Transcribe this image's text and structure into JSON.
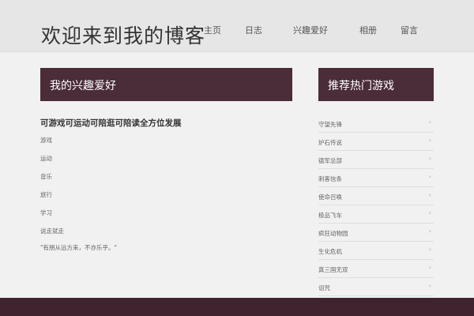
{
  "header": {
    "site_title": "欢迎来到我的博客",
    "nav": [
      "主页",
      "日志",
      "兴趣爱好",
      "相册",
      "留言"
    ]
  },
  "main": {
    "band_title": "我的兴趣爱好",
    "heading": "可游戏可运动可陪逛可陪读全方位发展",
    "hobbies": [
      "游戏",
      "运动",
      "音乐",
      "旅行",
      "学习",
      "说走就走"
    ],
    "quote": "\"有朋从远方来，不亦乐乎。\""
  },
  "sidebar": {
    "band_title": "推荐热门游戏",
    "games": [
      "守望先锋",
      "炉石传说",
      "德军总部",
      "刺客信条",
      "使命召唤",
      "极品飞车",
      "疯狂动物园",
      "生化危机",
      "真三国无双",
      "诅咒"
    ]
  },
  "colors": {
    "accent": "#4b2c39",
    "footer": "#3f2430"
  }
}
